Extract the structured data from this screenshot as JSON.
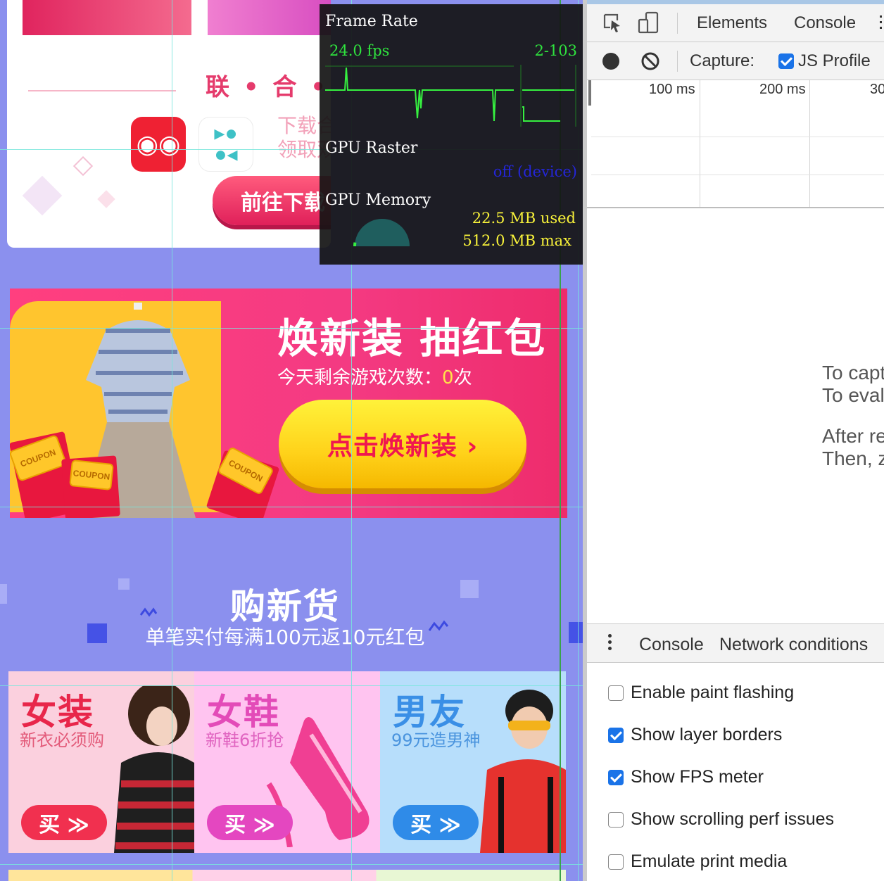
{
  "promo": {
    "union_title": "联 • 合 • 推 广",
    "download_line1": "下载合作APP",
    "download_line2": "领取双日优惠券~",
    "download_button": "前往下载",
    "banner_title": "焕新装 抽红包",
    "banner_sub_prefix": "今天剩余游戏次数：",
    "banner_sub_count": "0",
    "banner_sub_suffix": "次",
    "banner_button": "点击焕新装 ›",
    "coupon_label": "COUPON",
    "section_title": "购新货",
    "section_sub": "单笔实付每满100元返10元红包",
    "cards": [
      {
        "title": "女装",
        "sub": "新衣必须购",
        "buy": "买 ≫",
        "title_color": "#e8264a",
        "sub_color": "#e35b7a",
        "bg": "#fbd0de",
        "btn": "#f1304f"
      },
      {
        "title": "女鞋",
        "sub": "新鞋6折抢",
        "buy": "买 ≫",
        "title_color": "#e34bb8",
        "sub_color": "#e064c0",
        "bg": "#ffc4f0",
        "btn": "#e447c0"
      },
      {
        "title": "男友",
        "sub": "99元造男神",
        "buy": "买 ≫",
        "title_color": "#3a8fe6",
        "sub_color": "#4a94de",
        "bg": "#b7defb",
        "btn": "#2f8be8"
      }
    ]
  },
  "fps_meter": {
    "frame_rate_label": "Frame Rate",
    "fps_value": "24.0 fps",
    "fps_range": "2-103",
    "gpu_raster_label": "GPU Raster",
    "gpu_raster_status": "off (device)",
    "gpu_memory_label": "GPU Memory",
    "memory_used": "22.5 MB used",
    "memory_max": "512.0 MB max",
    "memory_used_fraction": 0.044
  },
  "devtools": {
    "tabs": [
      "Elements",
      "Console"
    ],
    "capture_label": "Capture:",
    "js_profile_label": "JS Profile",
    "js_profile_checked": true,
    "timeline_labels": [
      "100 ms",
      "200 ms",
      "30"
    ],
    "hint_lines": [
      "To capt",
      "To eval",
      "After re",
      "Then, z"
    ],
    "drawer_tabs": [
      "Console",
      "Network conditions"
    ],
    "rendering_options": [
      {
        "label": "Enable paint flashing",
        "checked": false
      },
      {
        "label": "Show layer borders",
        "checked": true
      },
      {
        "label": "Show FPS meter",
        "checked": true
      },
      {
        "label": "Show scrolling perf issues",
        "checked": false
      },
      {
        "label": "Emulate print media",
        "checked": false
      }
    ],
    "colors": {
      "accent": "#1a73e8",
      "toolbar_bg": "#f3f3f3"
    }
  }
}
